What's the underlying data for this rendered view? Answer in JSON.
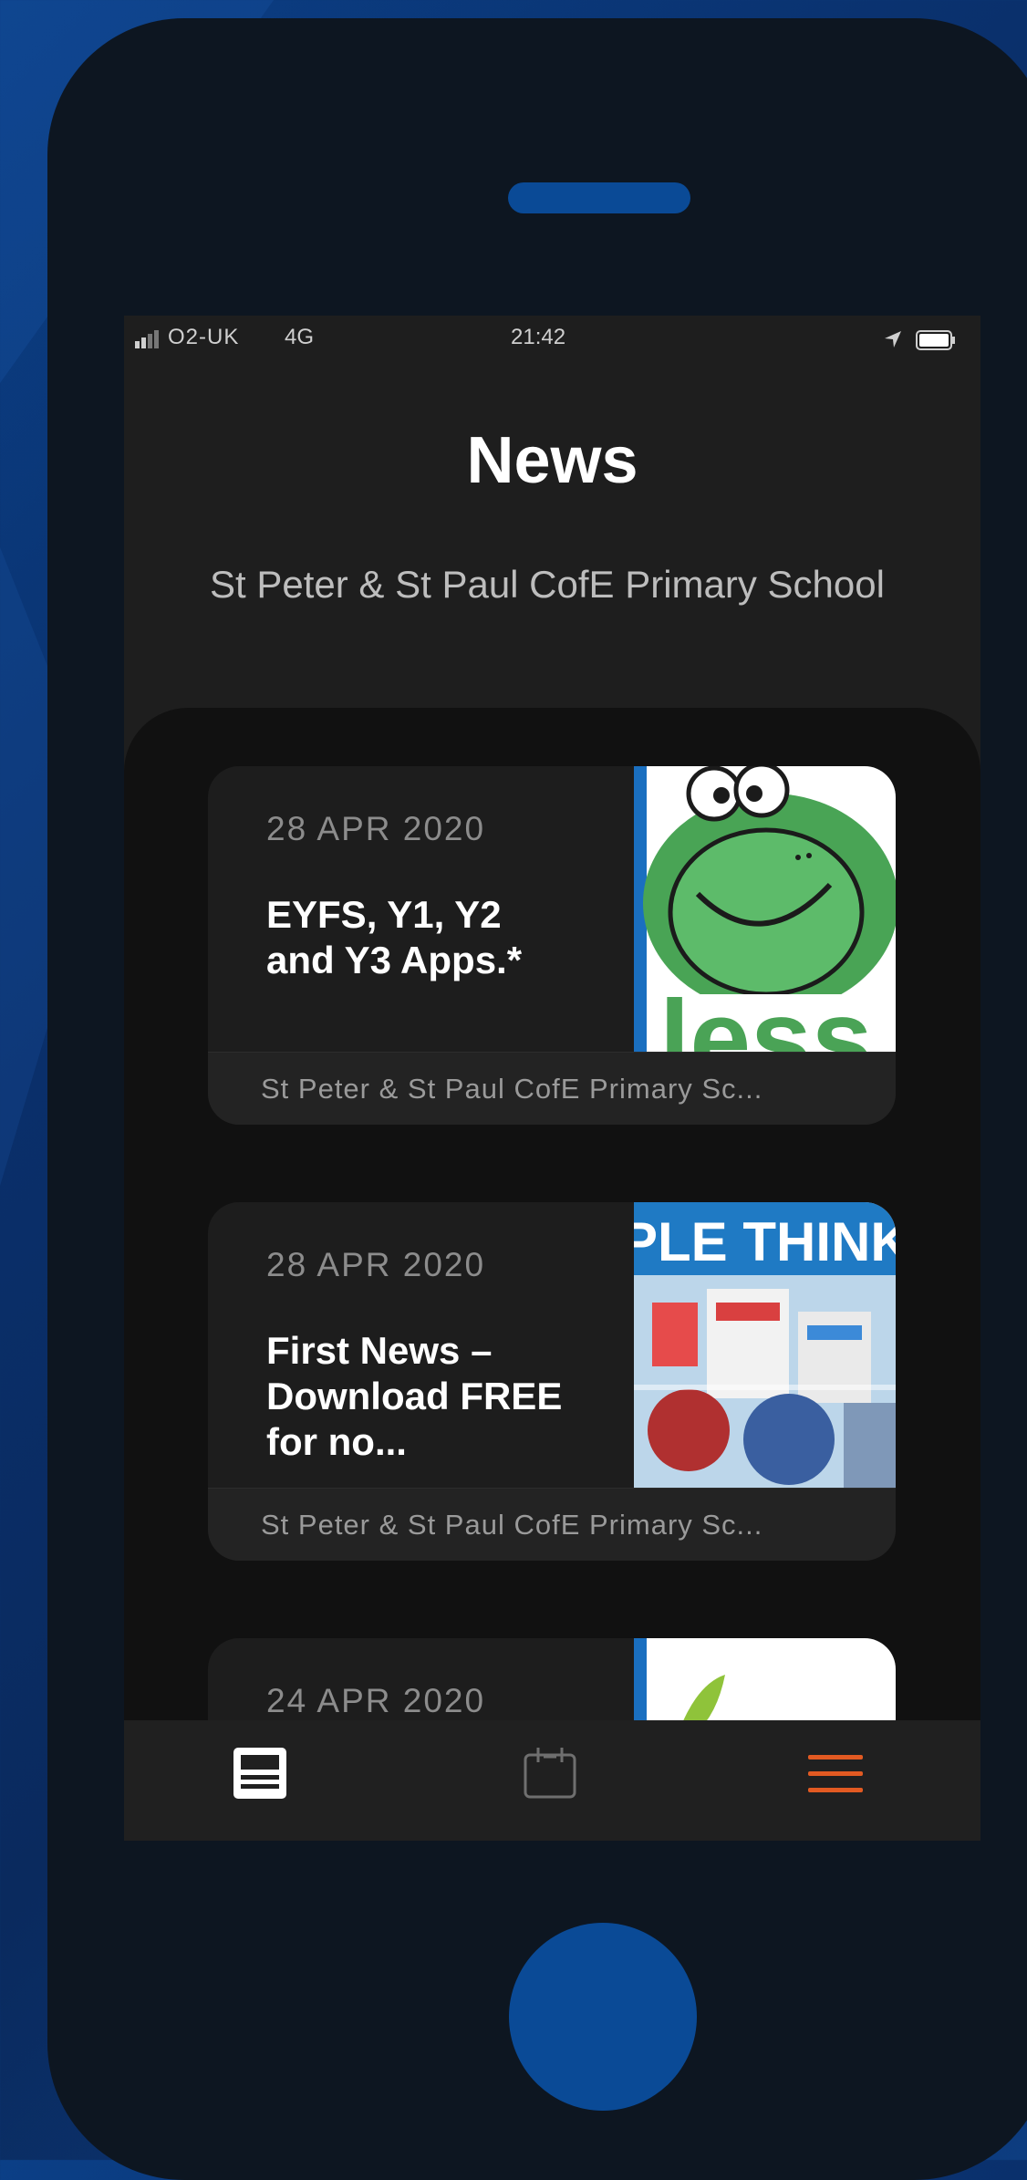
{
  "status_bar": {
    "carrier": "O2-UK",
    "network": "4G",
    "time": "21:42"
  },
  "header": {
    "title": "News",
    "subtitle": "St Peter & St Paul CofE Primary School"
  },
  "news_items": [
    {
      "date": "28 APR 2020",
      "title": "EYFS, Y1, Y2 and Y3 Apps.*",
      "source": "St Peter & St Paul CofE Primary Sc...",
      "thumbnail_text": "less"
    },
    {
      "date": "28 APR 2020",
      "title": "First News – Download FREE for no...",
      "source": "St Peter & St Paul CofE Primary Sc...",
      "thumbnail_text": "PLE THINK"
    },
    {
      "date": "24 APR 2020",
      "title": "",
      "source": ""
    }
  ],
  "tab_bar": {
    "tabs": [
      {
        "icon": "news-icon",
        "active": true
      },
      {
        "icon": "calendar-icon",
        "active": false
      },
      {
        "icon": "menu-icon",
        "active": false
      }
    ],
    "accent_color": "#e25a22"
  },
  "colors": {
    "background": "#0a2f6a",
    "phone_body": "#0d1621",
    "phone_buttons": "#0a4a96",
    "screen": "#1e1e1e",
    "card": "#1d1d1d"
  }
}
